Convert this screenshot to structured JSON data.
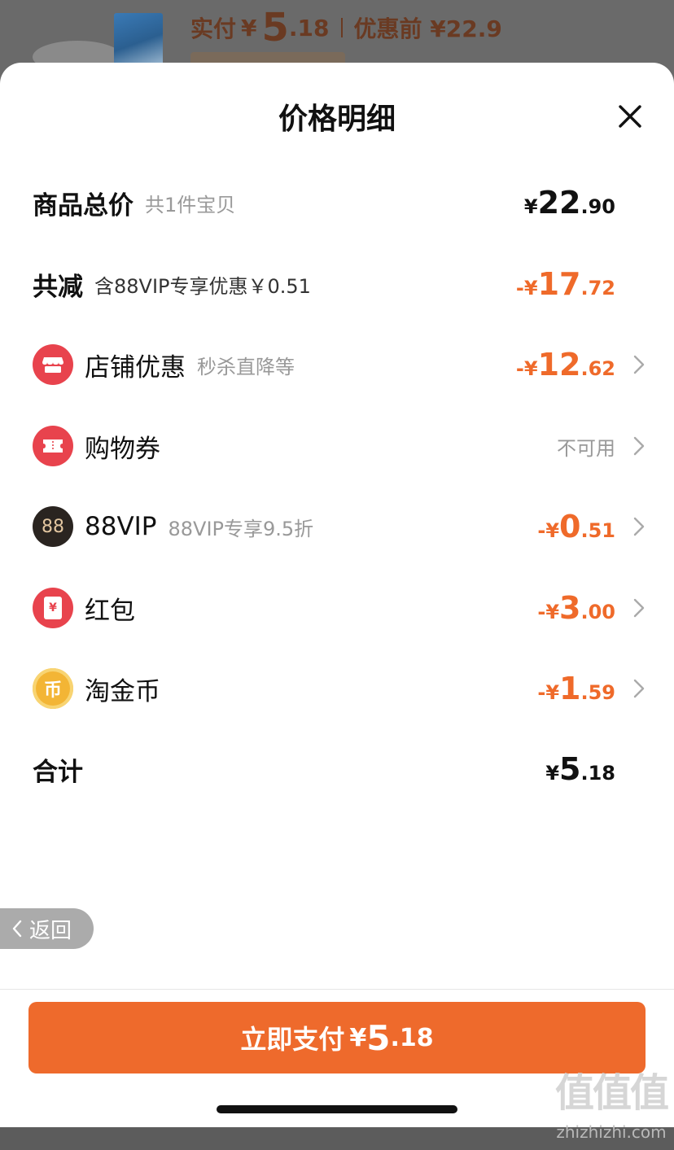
{
  "background": {
    "price_label": "实付",
    "yen": "¥",
    "price_int": "5",
    "price_dec": ".18",
    "pre_price": "优惠前 ¥22.9"
  },
  "sheet": {
    "title": "价格明细",
    "rows": [
      {
        "label": "商品总价",
        "sub": "共1件宝贝",
        "yen": "¥",
        "int": "22",
        "dec": ".90"
      },
      {
        "label": "共减",
        "sub": "含88VIP专享优惠￥0.51",
        "yen": "-¥",
        "int": "17",
        "dec": ".72"
      },
      {
        "label": "店铺优惠",
        "sub": "秒杀直降等",
        "yen": "-¥",
        "int": "12",
        "dec": ".62"
      },
      {
        "label": "购物券",
        "right_text": "不可用"
      },
      {
        "label": "88VIP",
        "sub": "88VIP专享9.5折",
        "icon_text": "88",
        "yen": "-¥",
        "int": "0",
        "dec": ".51"
      },
      {
        "label": "红包",
        "icon_text": "¥",
        "yen": "-¥",
        "int": "3",
        "dec": ".00"
      },
      {
        "label": "淘金币",
        "icon_text": "币",
        "yen": "-¥",
        "int": "1",
        "dec": ".59"
      },
      {
        "label": "合计",
        "yen": "¥",
        "int": "5",
        "dec": ".18"
      }
    ],
    "back_label": "返回",
    "pay": {
      "label": "立即支付",
      "yen": "¥",
      "int": "5",
      "dec": ".18"
    }
  },
  "watermark": {
    "big": "值值值",
    "small": "zhizhizhi.com"
  },
  "icons": [
    "close-icon",
    "store-icon",
    "coupon-icon",
    "vip88-icon",
    "red-packet-icon",
    "taojinbi-icon",
    "chevron-right-icon",
    "chevron-left-icon"
  ],
  "colors": {
    "accent": "#ee6a2c",
    "discount": "#ef6a2a",
    "icon_red": "#e8434d",
    "vip_black": "#2a2420",
    "coin_gold": "#f3b535"
  }
}
